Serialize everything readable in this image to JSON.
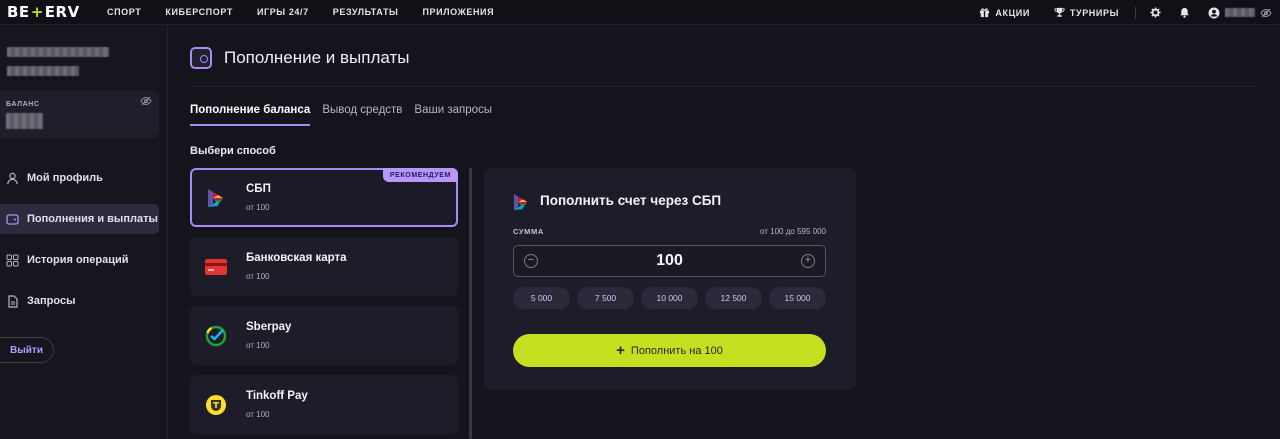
{
  "header": {
    "logo": {
      "left": "BE",
      "plus": "+",
      "right": "ERV"
    },
    "nav": [
      "СПОРТ",
      "КИБЕРСПОРТ",
      "ИГРЫ 24/7",
      "РЕЗУЛЬТАТЫ",
      "ПРИЛОЖЕНИЯ"
    ],
    "promo_label": "АКЦИИ",
    "tournaments_label": "ТУРНИРЫ",
    "icons": [
      "gift-icon",
      "trophy-icon",
      "gear-icon",
      "bell-icon",
      "user-icon",
      "eye-off-icon"
    ]
  },
  "sidebar": {
    "balance_label": "БАЛАНС",
    "menu": [
      {
        "label": "Мой профиль",
        "icon": "user-icon",
        "active": false
      },
      {
        "label": "Пополнения и выплаты",
        "icon": "wallet-icon",
        "active": true
      },
      {
        "label": "История операций",
        "icon": "grid-icon",
        "active": false
      },
      {
        "label": "Запросы",
        "icon": "document-icon",
        "active": false
      }
    ],
    "logout_label": "Выйти"
  },
  "main": {
    "title": "Пополнение и выплаты",
    "tabs": [
      {
        "label": "Пополнение баланса",
        "active": true
      },
      {
        "label": "Вывод средств",
        "active": false
      },
      {
        "label": "Ваши запросы",
        "active": false
      }
    ],
    "choose_label": "Выбери способ",
    "methods": [
      {
        "name": "СБП",
        "min": "от 100",
        "icon": "sbp-icon",
        "selected": true,
        "badge": "РЕКОМЕНДУЕМ"
      },
      {
        "name": "Банковская карта",
        "min": "от 100",
        "icon": "bank-card-icon",
        "selected": false
      },
      {
        "name": "Sberpay",
        "min": "от 100",
        "icon": "sberpay-icon",
        "selected": false
      },
      {
        "name": "Tinkoff Pay",
        "min": "от 100",
        "icon": "tinkoff-icon",
        "selected": false
      }
    ]
  },
  "panel": {
    "title": "Пополнить счет через СБП",
    "sum_label": "СУММА",
    "range": "от 100 до 595 000",
    "amount": "100",
    "minus": "−",
    "plus": "+",
    "presets": [
      "5 000",
      "7 500",
      "10 000",
      "12 500",
      "15 000"
    ],
    "submit_plus": "+",
    "submit_label": "Пополнить на 100"
  },
  "colors": {
    "accent": "#a98af0",
    "submit": "#c6df21",
    "background": "#14141c",
    "card": "#1d1d29"
  }
}
